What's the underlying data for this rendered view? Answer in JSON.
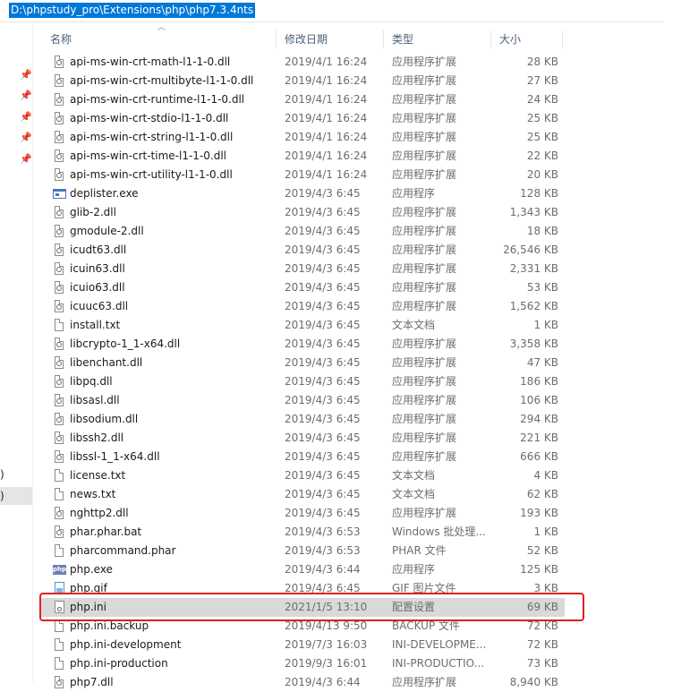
{
  "address_bar": {
    "path": "D:\\phpstudy_pro\\Extensions\\php\\php7.3.4nts"
  },
  "nav": {
    "fragments": [
      ")",
      ")"
    ]
  },
  "columns": {
    "name": "名称",
    "modified": "修改日期",
    "type": "类型",
    "size": "大小"
  },
  "files": [
    {
      "name": "api-ms-win-crt-math-l1-1-0.dll",
      "date": "2019/4/1 16:24",
      "type": "应用程序扩展",
      "size": "28 KB",
      "icon": "dll-icon"
    },
    {
      "name": "api-ms-win-crt-multibyte-l1-1-0.dll",
      "date": "2019/4/1 16:24",
      "type": "应用程序扩展",
      "size": "27 KB",
      "icon": "dll-icon"
    },
    {
      "name": "api-ms-win-crt-runtime-l1-1-0.dll",
      "date": "2019/4/1 16:24",
      "type": "应用程序扩展",
      "size": "24 KB",
      "icon": "dll-icon"
    },
    {
      "name": "api-ms-win-crt-stdio-l1-1-0.dll",
      "date": "2019/4/1 16:24",
      "type": "应用程序扩展",
      "size": "25 KB",
      "icon": "dll-icon"
    },
    {
      "name": "api-ms-win-crt-string-l1-1-0.dll",
      "date": "2019/4/1 16:24",
      "type": "应用程序扩展",
      "size": "25 KB",
      "icon": "dll-icon"
    },
    {
      "name": "api-ms-win-crt-time-l1-1-0.dll",
      "date": "2019/4/1 16:24",
      "type": "应用程序扩展",
      "size": "22 KB",
      "icon": "dll-icon"
    },
    {
      "name": "api-ms-win-crt-utility-l1-1-0.dll",
      "date": "2019/4/1 16:24",
      "type": "应用程序扩展",
      "size": "20 KB",
      "icon": "dll-icon"
    },
    {
      "name": "deplister.exe",
      "date": "2019/4/3 6:45",
      "type": "应用程序",
      "size": "128 KB",
      "icon": "exe-icon"
    },
    {
      "name": "glib-2.dll",
      "date": "2019/4/3 6:45",
      "type": "应用程序扩展",
      "size": "1,343 KB",
      "icon": "dll-icon"
    },
    {
      "name": "gmodule-2.dll",
      "date": "2019/4/3 6:45",
      "type": "应用程序扩展",
      "size": "18 KB",
      "icon": "dll-icon"
    },
    {
      "name": "icudt63.dll",
      "date": "2019/4/3 6:45",
      "type": "应用程序扩展",
      "size": "26,546 KB",
      "icon": "dll-icon"
    },
    {
      "name": "icuin63.dll",
      "date": "2019/4/3 6:45",
      "type": "应用程序扩展",
      "size": "2,331 KB",
      "icon": "dll-icon"
    },
    {
      "name": "icuio63.dll",
      "date": "2019/4/3 6:45",
      "type": "应用程序扩展",
      "size": "53 KB",
      "icon": "dll-icon"
    },
    {
      "name": "icuuc63.dll",
      "date": "2019/4/3 6:45",
      "type": "应用程序扩展",
      "size": "1,562 KB",
      "icon": "dll-icon"
    },
    {
      "name": "install.txt",
      "date": "2019/4/3 6:45",
      "type": "文本文档",
      "size": "1 KB",
      "icon": "text-file-icon"
    },
    {
      "name": "libcrypto-1_1-x64.dll",
      "date": "2019/4/3 6:45",
      "type": "应用程序扩展",
      "size": "3,358 KB",
      "icon": "dll-icon"
    },
    {
      "name": "libenchant.dll",
      "date": "2019/4/3 6:45",
      "type": "应用程序扩展",
      "size": "47 KB",
      "icon": "dll-icon"
    },
    {
      "name": "libpq.dll",
      "date": "2019/4/3 6:45",
      "type": "应用程序扩展",
      "size": "186 KB",
      "icon": "dll-icon"
    },
    {
      "name": "libsasl.dll",
      "date": "2019/4/3 6:45",
      "type": "应用程序扩展",
      "size": "106 KB",
      "icon": "dll-icon"
    },
    {
      "name": "libsodium.dll",
      "date": "2019/4/3 6:45",
      "type": "应用程序扩展",
      "size": "294 KB",
      "icon": "dll-icon"
    },
    {
      "name": "libssh2.dll",
      "date": "2019/4/3 6:45",
      "type": "应用程序扩展",
      "size": "221 KB",
      "icon": "dll-icon"
    },
    {
      "name": "libssl-1_1-x64.dll",
      "date": "2019/4/3 6:45",
      "type": "应用程序扩展",
      "size": "666 KB",
      "icon": "dll-icon"
    },
    {
      "name": "license.txt",
      "date": "2019/4/3 6:45",
      "type": "文本文档",
      "size": "4 KB",
      "icon": "text-file-icon"
    },
    {
      "name": "news.txt",
      "date": "2019/4/3 6:45",
      "type": "文本文档",
      "size": "62 KB",
      "icon": "text-file-icon"
    },
    {
      "name": "nghttp2.dll",
      "date": "2019/4/3 6:45",
      "type": "应用程序扩展",
      "size": "193 KB",
      "icon": "dll-icon"
    },
    {
      "name": "phar.phar.bat",
      "date": "2019/4/3 6:53",
      "type": "Windows 批处理...",
      "size": "1 KB",
      "icon": "batch-file-icon"
    },
    {
      "name": "pharcommand.phar",
      "date": "2019/4/3 6:53",
      "type": "PHAR 文件",
      "size": "52 KB",
      "icon": "file-icon"
    },
    {
      "name": "php.exe",
      "date": "2019/4/3 6:44",
      "type": "应用程序",
      "size": "125 KB",
      "icon": "php-icon"
    },
    {
      "name": "php.gif",
      "date": "2019/4/3 6:45",
      "type": "GIF 图片文件",
      "size": "3 KB",
      "icon": "image-file-icon"
    },
    {
      "name": "php.ini",
      "date": "2021/1/5 13:10",
      "type": "配置设置",
      "size": "69 KB",
      "icon": "ini-file-icon",
      "selected": true
    },
    {
      "name": "php.ini.backup",
      "date": "2019/4/13 9:50",
      "type": "BACKUP 文件",
      "size": "72 KB",
      "icon": "file-icon"
    },
    {
      "name": "php.ini-development",
      "date": "2019/7/3 16:03",
      "type": "INI-DEVELOPME...",
      "size": "72 KB",
      "icon": "file-icon"
    },
    {
      "name": "php.ini-production",
      "date": "2019/9/3 16:01",
      "type": "INI-PRODUCTIO...",
      "size": "73 KB",
      "icon": "file-icon"
    },
    {
      "name": "php7.dll",
      "date": "2019/4/3 6:44",
      "type": "应用程序扩展",
      "size": "8,940 KB",
      "icon": "dll-icon"
    }
  ],
  "colors": {
    "selection": "#d9d9d9",
    "highlight_box": "#e0201e",
    "address_selection": "#0078d7"
  }
}
